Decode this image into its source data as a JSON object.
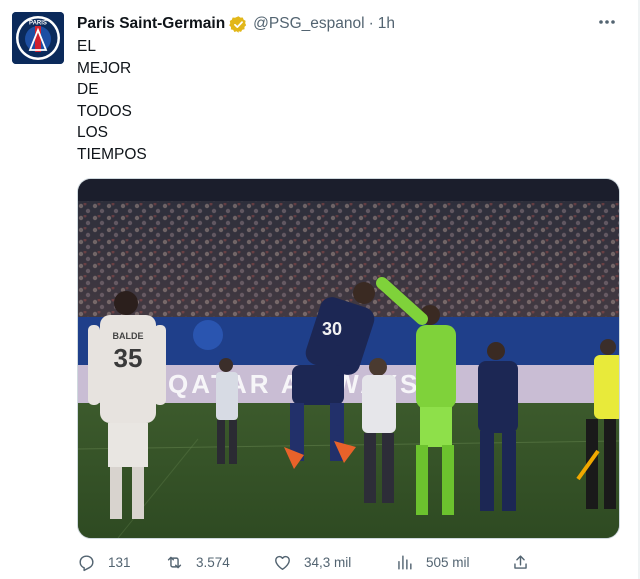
{
  "author": {
    "display_name": "Paris Saint-Germain",
    "handle": "@PSG_espanol",
    "separator": "·",
    "time": "1h",
    "verified": true,
    "avatar_text": "PARIS"
  },
  "more_icon": "more-horizontal-icon",
  "tweet": {
    "lines": [
      "EL",
      "MEJOR",
      "DE",
      "TODOS",
      "LOS",
      "TIEMPOS"
    ]
  },
  "media": {
    "banner_text": "QATAR AIRWAYS",
    "player_back_name": "BALDE",
    "player_back_number": "35",
    "player_number_front": "30"
  },
  "actions": {
    "reply_count": "131",
    "retweet_count": "3.574",
    "like_count": "34,3 mil",
    "views_count": "505 mil"
  },
  "colors": {
    "text": "#0f1419",
    "secondary": "#536471",
    "verified_gold": "#e2b719",
    "psg_navy": "#0b2a5b"
  }
}
